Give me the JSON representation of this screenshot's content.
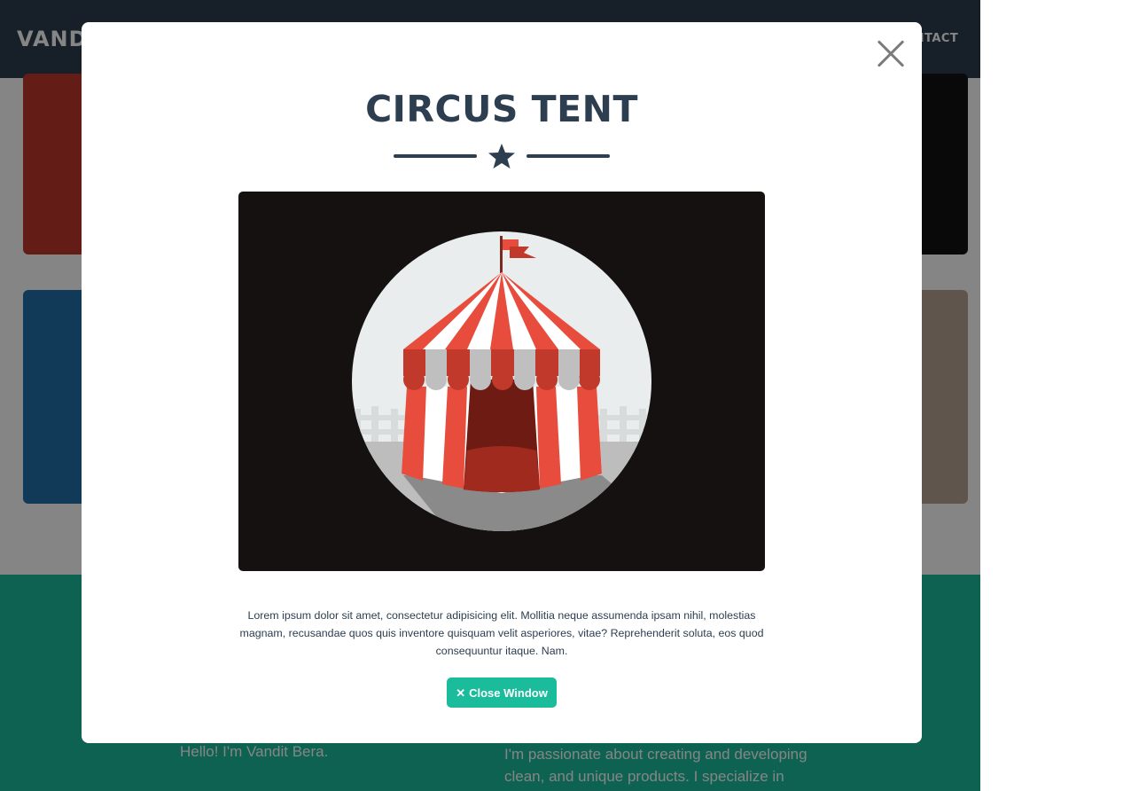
{
  "navbar": {
    "brand": "VANDIT",
    "contact_link": "CONTACT"
  },
  "about": {
    "intro": "Hello! I'm Vandit Bera.",
    "bio": "I'm passionate about creating and developing clean, and unique products. I specialize in"
  },
  "modal": {
    "title": "CIRCUS TENT",
    "image_subject": "circus-tent",
    "description": "Lorem ipsum dolor sit amet, consectetur adipisicing elit. Mollitia neque assumenda ipsam nihil, molestias magnam, recusandae quos quis inventore quisquam velit asperiores, vitae? Reprehenderit soluta, eos quod consequuntur itaque. Nam.",
    "close_button_label": "Close Window",
    "close_button_icon": "times-icon",
    "close_icon": "close-icon"
  },
  "colors": {
    "primary": "#2c3e50",
    "accent": "#1abc9c",
    "modal_bg": "#ffffff",
    "image_bg": "#141110",
    "tent_red": "#e74c3c",
    "tent_dark_red": "#c0392b"
  }
}
